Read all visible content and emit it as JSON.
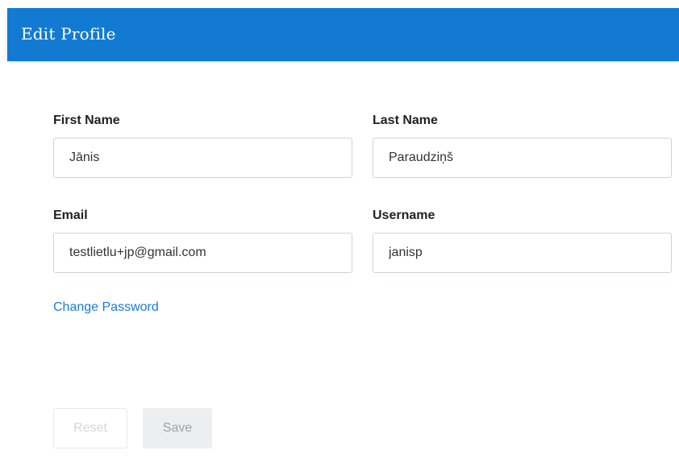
{
  "header": {
    "title": "Edit Profile",
    "background_color": "#127bd1"
  },
  "form": {
    "first_name": {
      "label": "First Name",
      "value": "Jānis"
    },
    "last_name": {
      "label": "Last Name",
      "value": "Paraudziņš"
    },
    "email": {
      "label": "Email",
      "value": "testlietlu+jp@gmail.com"
    },
    "username": {
      "label": "Username",
      "value": "janisp"
    }
  },
  "links": {
    "change_password": "Change Password"
  },
  "buttons": {
    "reset": {
      "label": "Reset",
      "state": "disabled"
    },
    "save": {
      "label": "Save",
      "state": "disabled"
    }
  }
}
